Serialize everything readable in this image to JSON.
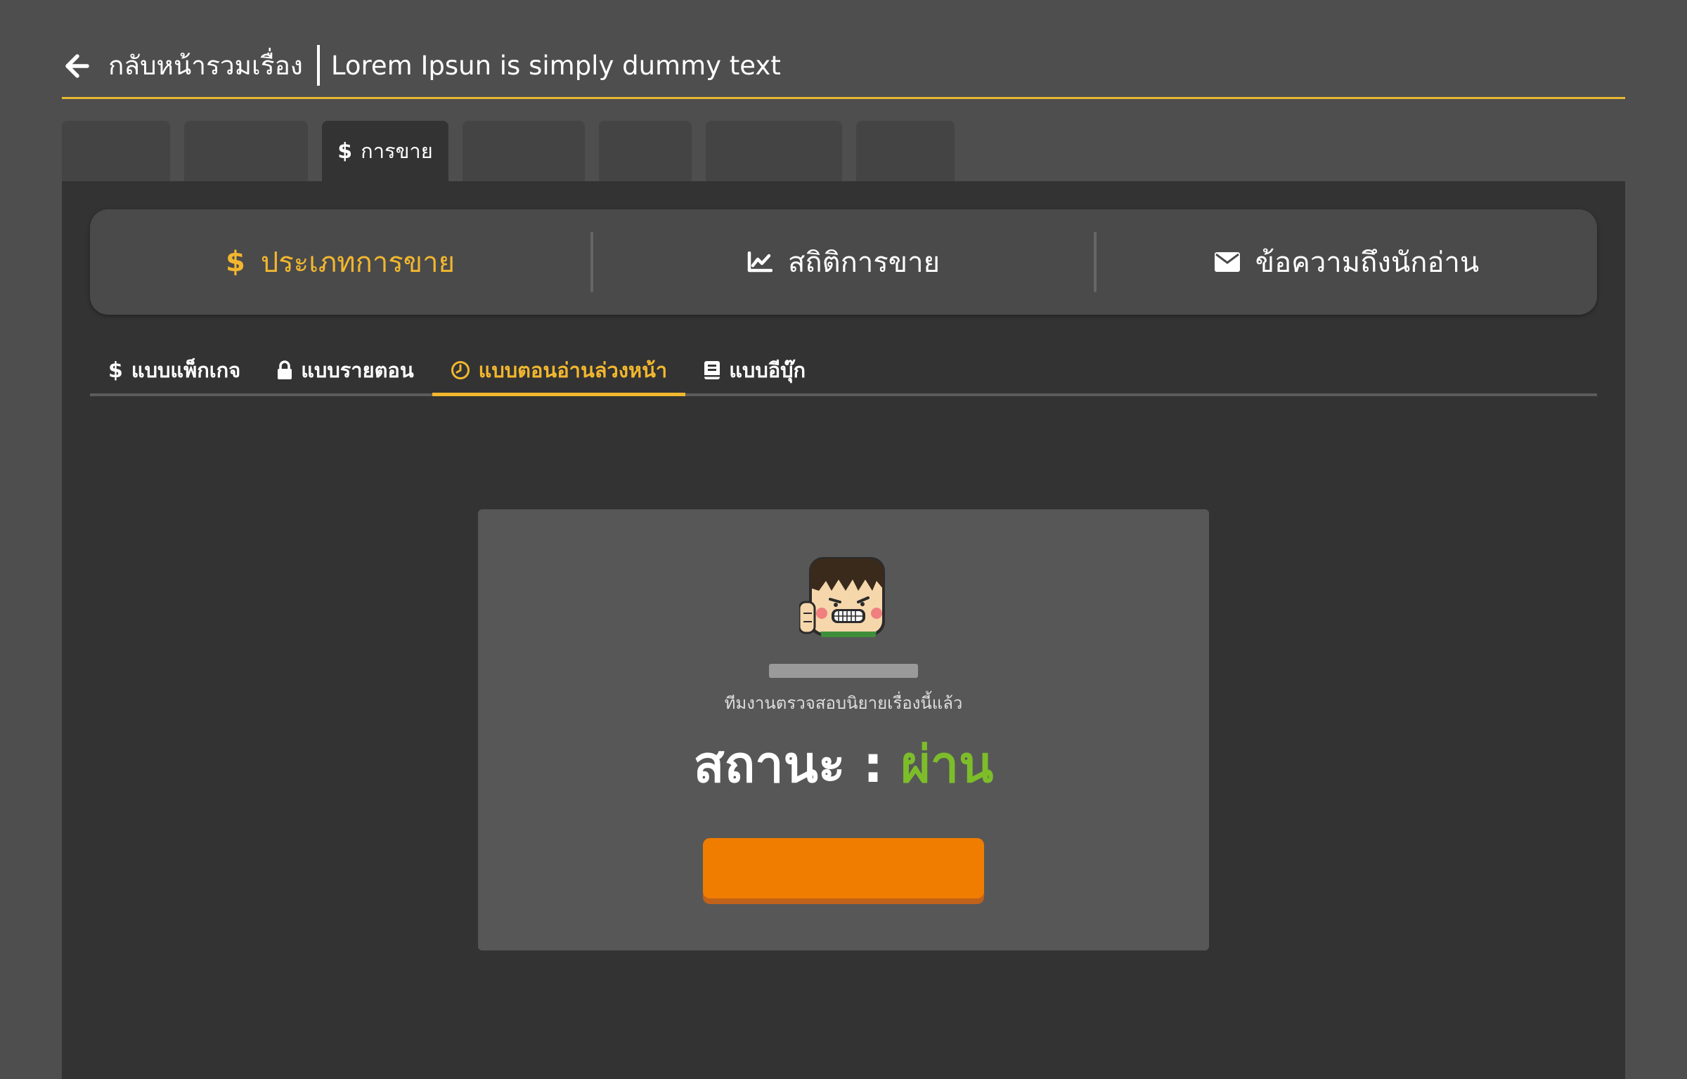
{
  "header": {
    "back_label": "กลับหน้ารวมเรื่อง",
    "story_title": "Lorem Ipsun is simply dummy text",
    "accent_color": "#e9b733"
  },
  "top_tabs": {
    "active_label": "การขาย"
  },
  "sales_nav": {
    "sale_types": "ประเภทการขาย",
    "sale_stats": "สถิติการขาย",
    "reader_message": "ข้อความถึงนักอ่าน"
  },
  "sub_tabs": {
    "package": "แบบแพ็กเกจ",
    "per_episode": "แบบรายตอน",
    "early_access": "แบบตอนอ่านล่วงหน้า",
    "ebook": "แบบอีบุ๊ก"
  },
  "status_card": {
    "review_note": "ทีมงานตรวจสอบนิยายเรื่องนี้แล้ว",
    "status_label": "สถานะ : ",
    "status_value": "ผ่าน",
    "status_color": "#7dbd2a",
    "button_color": "#f07c00"
  },
  "icons": [
    "arrow-left-icon",
    "dollar-icon",
    "chart-line-icon",
    "envelope-icon",
    "lock-icon",
    "clock-icon",
    "book-icon",
    "mascot-icon"
  ]
}
